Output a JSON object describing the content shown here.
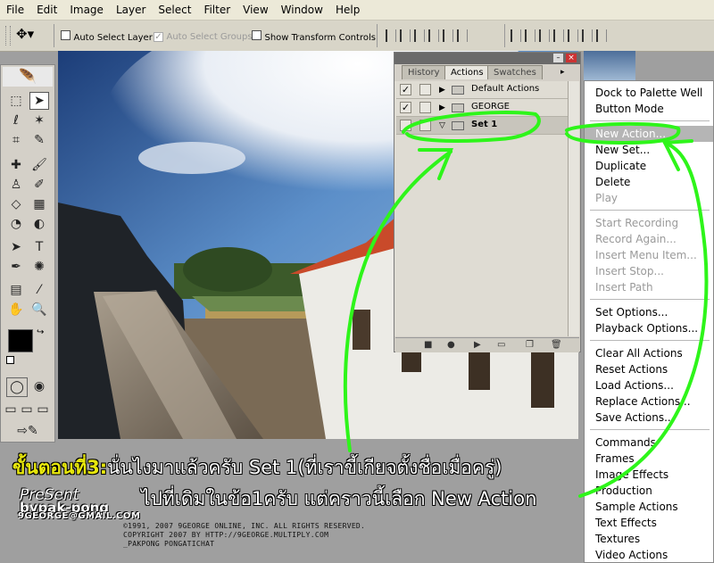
{
  "menubar": {
    "items": [
      "File",
      "Edit",
      "Image",
      "Layer",
      "Select",
      "Filter",
      "View",
      "Window",
      "Help"
    ]
  },
  "options": {
    "auto_select_layer": {
      "label": "Auto Select Layer",
      "checked": false
    },
    "auto_select_groups": {
      "label": "Auto Select Groups",
      "checked": true,
      "disabled": true
    },
    "show_transform": {
      "label": "Show Transform Controls",
      "checked": false
    }
  },
  "palette": {
    "tabs": [
      "History",
      "Actions",
      "Swatches"
    ],
    "active_tab": "Actions",
    "actions": [
      {
        "name": "Default Actions",
        "checked": true
      },
      {
        "name": "GEORGE",
        "checked": true
      },
      {
        "name": "Set 1",
        "checked": false,
        "selected": true
      }
    ]
  },
  "menu": {
    "items": [
      {
        "label": "Dock to Palette Well"
      },
      {
        "label": "Button Mode"
      },
      {
        "sep": true
      },
      {
        "label": "New Action...",
        "highlighted": true
      },
      {
        "label": "New Set..."
      },
      {
        "label": "Duplicate"
      },
      {
        "label": "Delete"
      },
      {
        "label": "Play",
        "disabled": true
      },
      {
        "sep": true
      },
      {
        "label": "Start Recording",
        "disabled": true
      },
      {
        "label": "Record Again...",
        "disabled": true
      },
      {
        "label": "Insert Menu Item...",
        "disabled": true
      },
      {
        "label": "Insert Stop...",
        "disabled": true
      },
      {
        "label": "Insert Path",
        "disabled": true
      },
      {
        "sep": true
      },
      {
        "label": "Set Options..."
      },
      {
        "label": "Playback Options..."
      },
      {
        "sep": true
      },
      {
        "label": "Clear All Actions"
      },
      {
        "label": "Reset Actions"
      },
      {
        "label": "Load Actions..."
      },
      {
        "label": "Replace Actions..."
      },
      {
        "label": "Save Actions..."
      },
      {
        "sep": true
      },
      {
        "label": "Commands"
      },
      {
        "label": "Frames"
      },
      {
        "label": "Image Effects"
      },
      {
        "label": "Production"
      },
      {
        "label": "Sample Actions"
      },
      {
        "label": "Text Effects"
      },
      {
        "label": "Textures"
      },
      {
        "label": "Video Actions"
      }
    ]
  },
  "caption": {
    "step": "ขั้นตอนที่3:",
    "line1": "นั่นไงมาแล้วครับ Set 1(ที่เราขี้เกียจตั้งชื่อเมื่อครู่)",
    "line2": "ไปที่เดิมในข้อ1ครับ แต่คราวนี้เลือก New Action"
  },
  "credit": {
    "present": "PreSent",
    "by": "bypak-pong",
    "email": "9GEORGE@GMAIL.COM",
    "copy1": "©1991, 2007 9GEORGE ONLINE, INC. ALL RIGHTS RESERVED.",
    "copy2": "COPYRIGHT 2007 BY   HTTP://9GEORGE.MULTIPLY.COM",
    "copy3": "_PAKPONG PONGATICHAT"
  },
  "colors": {
    "annotation": "#2ef51a",
    "caption_yellow": "#e8e80c",
    "menu_highlight": "#b5b5b5"
  }
}
